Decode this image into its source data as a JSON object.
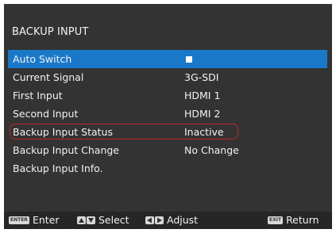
{
  "menu_title": "BACKUP INPUT",
  "rows": [
    {
      "label": "Auto Switch",
      "value": ""
    },
    {
      "label": "Current Signal",
      "value": "3G-SDI"
    },
    {
      "label": "First Input",
      "value": "HDMI 1"
    },
    {
      "label": "Second Input",
      "value": "HDMI 2"
    },
    {
      "label": "Backup Input Status",
      "value": "Inactive"
    },
    {
      "label": "Backup Input Change",
      "value": "No Change"
    },
    {
      "label": "Backup Input Info.",
      "value": ""
    }
  ],
  "auto_switch_checked": true,
  "colors": {
    "panel_bg": "#333333",
    "selection": "#1a78c9",
    "highlight_border": "#c0262b",
    "footer_bg": "#262626"
  },
  "footer": {
    "enter_key": "ENTER",
    "enter_label": "Enter",
    "select_label": "Select",
    "adjust_label": "Adjust",
    "exit_key": "EXIT",
    "return_label": "Return"
  }
}
